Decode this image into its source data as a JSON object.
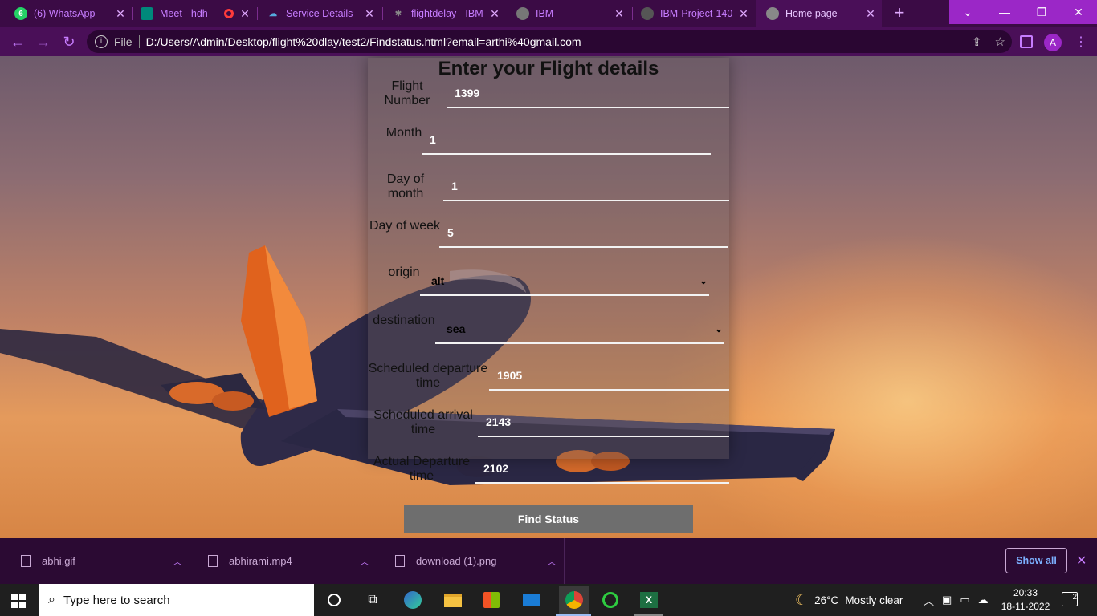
{
  "browser": {
    "tabs": [
      {
        "label": "(6) WhatsApp",
        "badge": "6"
      },
      {
        "label": "Meet - hdh-"
      },
      {
        "label": "Service Details -"
      },
      {
        "label": "flightdelay - IBM"
      },
      {
        "label": "IBM"
      },
      {
        "label": "IBM-Project-140"
      },
      {
        "label": "Home page"
      }
    ],
    "omnibox": {
      "scheme_label": "File",
      "url": "D:/Users/Admin/Desktop/flight%20dlay/test2/Findstatus.html?email=arthi%40gmail.com"
    },
    "profile_initial": "A"
  },
  "form": {
    "title": "Enter your Flight details",
    "fields": {
      "flight_number": {
        "label": "Flight Number",
        "value": "1399"
      },
      "month": {
        "label": "Month",
        "value": "1"
      },
      "day_of_month": {
        "label": "Day of month",
        "value": "1"
      },
      "day_of_week": {
        "label": "Day of week",
        "value": "5"
      },
      "origin": {
        "label": "origin",
        "value": "alt"
      },
      "destination": {
        "label": "destination",
        "value": "sea"
      },
      "scheduled_departure": {
        "label": "Scheduled departure time",
        "value": "1905"
      },
      "scheduled_arrival": {
        "label": "Scheduled arrival time",
        "value": "2143"
      },
      "actual_departure": {
        "label": "Actual Departure time",
        "value": "2102"
      }
    },
    "submit_label": "Find Status"
  },
  "downloads": {
    "items": [
      {
        "name": "abhi.gif"
      },
      {
        "name": "abhirami.mp4"
      },
      {
        "name": "download (1).png"
      }
    ],
    "show_all_label": "Show all"
  },
  "taskbar": {
    "search_placeholder": "Type here to search",
    "weather_temp": "26°C",
    "weather_text": "Mostly clear",
    "time": "20:33",
    "date": "18-11-2022",
    "notification_count": "2"
  },
  "colors": {
    "tabstrip": "#3b0b45",
    "toolbar": "#4a0f58",
    "accent": "#9b27c7",
    "button": "#6e6e6e"
  }
}
